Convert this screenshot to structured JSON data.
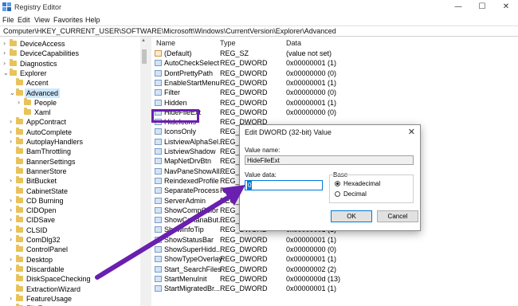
{
  "window": {
    "title": "Registry Editor",
    "controls": {
      "minimize": "—",
      "maximize": "☐",
      "close": "✕"
    }
  },
  "menu": [
    "File",
    "Edit",
    "View",
    "Favorites",
    "Help"
  ],
  "address": "Computer\\HKEY_CURRENT_USER\\SOFTWARE\\Microsoft\\Windows\\CurrentVersion\\Explorer\\Advanced",
  "tree": [
    {
      "label": "DeviceAccess",
      "level": 1,
      "expander": "›"
    },
    {
      "label": "DeviceCapabilities",
      "level": 1,
      "expander": "›"
    },
    {
      "label": "Diagnostics",
      "level": 1,
      "expander": "›"
    },
    {
      "label": "Explorer",
      "level": 1,
      "expander": "⌄"
    },
    {
      "label": "Accent",
      "level": 2,
      "expander": ""
    },
    {
      "label": "Advanced",
      "level": 2,
      "expander": "⌄",
      "selected": true
    },
    {
      "label": "People",
      "level": 3,
      "expander": "›"
    },
    {
      "label": "Xaml",
      "level": 3,
      "expander": ""
    },
    {
      "label": "AppContract",
      "level": 2,
      "expander": "›"
    },
    {
      "label": "AutoComplete",
      "level": 2,
      "expander": "›"
    },
    {
      "label": "AutoplayHandlers",
      "level": 2,
      "expander": "›"
    },
    {
      "label": "BamThrottling",
      "level": 2,
      "expander": ""
    },
    {
      "label": "BannerSettings",
      "level": 2,
      "expander": ""
    },
    {
      "label": "BannerStore",
      "level": 2,
      "expander": ""
    },
    {
      "label": "BitBucket",
      "level": 2,
      "expander": "›"
    },
    {
      "label": "CabinetState",
      "level": 2,
      "expander": ""
    },
    {
      "label": "CD Burning",
      "level": 2,
      "expander": "›"
    },
    {
      "label": "CIDOpen",
      "level": 2,
      "expander": "›"
    },
    {
      "label": "CIDSave",
      "level": 2,
      "expander": "›"
    },
    {
      "label": "CLSID",
      "level": 2,
      "expander": "›"
    },
    {
      "label": "ComDlg32",
      "level": 2,
      "expander": "›"
    },
    {
      "label": "ControlPanel",
      "level": 2,
      "expander": ""
    },
    {
      "label": "Desktop",
      "level": 2,
      "expander": "›"
    },
    {
      "label": "Discardable",
      "level": 2,
      "expander": "›"
    },
    {
      "label": "DiskSpaceChecking",
      "level": 2,
      "expander": ""
    },
    {
      "label": "ExtractionWizard",
      "level": 2,
      "expander": ""
    },
    {
      "label": "FeatureUsage",
      "level": 2,
      "expander": "›"
    },
    {
      "label": "FileExts",
      "level": 2,
      "expander": "›"
    }
  ],
  "columns": {
    "name": "Name",
    "type": "Type",
    "data": "Data"
  },
  "values": [
    {
      "name": "(Default)",
      "type": "REG_SZ",
      "data": "(value not set)",
      "kind": "sz"
    },
    {
      "name": "AutoCheckSelect",
      "type": "REG_DWORD",
      "data": "0x00000001 (1)",
      "kind": "dw"
    },
    {
      "name": "DontPrettyPath",
      "type": "REG_DWORD",
      "data": "0x00000000 (0)",
      "kind": "dw"
    },
    {
      "name": "EnableStartMenu",
      "type": "REG_DWORD",
      "data": "0x00000001 (1)",
      "kind": "dw"
    },
    {
      "name": "Filter",
      "type": "REG_DWORD",
      "data": "0x00000000 (0)",
      "kind": "dw"
    },
    {
      "name": "Hidden",
      "type": "REG_DWORD",
      "data": "0x00000001 (1)",
      "kind": "dw"
    },
    {
      "name": "HideFileExt",
      "type": "REG_DWORD",
      "data": "0x00000000 (0)",
      "kind": "dw"
    },
    {
      "name": "HideIcons",
      "type": "REG_DWORD",
      "data": "",
      "kind": "dw"
    },
    {
      "name": "IconsOnly",
      "type": "REG_D",
      "data": "",
      "kind": "dw"
    },
    {
      "name": "ListviewAlphaSel...",
      "type": "REG_D",
      "data": "",
      "kind": "dw"
    },
    {
      "name": "ListviewShadow",
      "type": "REG_D",
      "data": "",
      "kind": "dw"
    },
    {
      "name": "MapNetDrvBtn",
      "type": "REG_D",
      "data": "",
      "kind": "dw"
    },
    {
      "name": "NavPaneShowAll...",
      "type": "REG_D",
      "data": "",
      "kind": "dw"
    },
    {
      "name": "ReindexedProfile",
      "type": "REG_D",
      "data": "",
      "kind": "dw"
    },
    {
      "name": "SeparateProcess",
      "type": "REG_D",
      "data": "",
      "kind": "dw"
    },
    {
      "name": "ServerAdmin",
      "type": "REG_D",
      "data": "",
      "kind": "dw"
    },
    {
      "name": "ShowCompColor",
      "type": "REG_D",
      "data": "",
      "kind": "dw"
    },
    {
      "name": "ShowCortanaBut...",
      "type": "REG_D",
      "data": "",
      "kind": "dw"
    },
    {
      "name": "ShowInfoTip",
      "type": "REG_DWORD",
      "data": "0x00000001 (1)",
      "kind": "dw"
    },
    {
      "name": "ShowStatusBar",
      "type": "REG_DWORD",
      "data": "0x00000001 (1)",
      "kind": "dw"
    },
    {
      "name": "ShowSuperHidd...",
      "type": "REG_DWORD",
      "data": "0x00000000 (0)",
      "kind": "dw"
    },
    {
      "name": "ShowTypeOverlay",
      "type": "REG_DWORD",
      "data": "0x00000001 (1)",
      "kind": "dw"
    },
    {
      "name": "Start_SearchFiles",
      "type": "REG_DWORD",
      "data": "0x00000002 (2)",
      "kind": "dw"
    },
    {
      "name": "StartMenuInit",
      "type": "REG_DWORD",
      "data": "0x0000000d (13)",
      "kind": "dw"
    },
    {
      "name": "StartMigratedBr...",
      "type": "REG_DWORD",
      "data": "0x00000001 (1)",
      "kind": "dw"
    }
  ],
  "dialog": {
    "title": "Edit DWORD (32-bit) Value",
    "close": "✕",
    "value_name_label": "Value name:",
    "value_name": "HideFileExt",
    "value_data_label": "Value data:",
    "value_data": "0",
    "base_label": "Base",
    "hex_label": "Hexadecimal",
    "dec_label": "Decimal",
    "base_selected": "Hexadecimal",
    "ok_label": "OK",
    "cancel_label": "Cancel"
  },
  "colors": {
    "accent": "#6a1fb0",
    "selection": "#cce8ff",
    "focus": "#0078d7",
    "folder": "#e8c25a"
  }
}
